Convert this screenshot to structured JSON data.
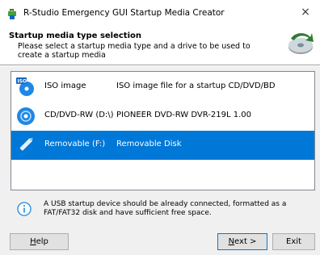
{
  "window": {
    "title": "R-Studio Emergency GUI Startup Media Creator",
    "close_label": "×"
  },
  "header": {
    "title": "Startup media type selection",
    "description": "Please select a startup media type and a drive to be used to create a startup media"
  },
  "media_list": [
    {
      "name": "ISO image",
      "description": "ISO image file for a startup CD/DVD/BD",
      "icon": "iso-icon",
      "selected": false
    },
    {
      "name": "CD/DVD-RW (D:\\)",
      "description": "PIONEER DVD-RW DVR-219L 1.00",
      "icon": "optical-disc-icon",
      "selected": false
    },
    {
      "name": "Removable (F:)",
      "description": "Removable Disk",
      "icon": "usb-drive-icon",
      "selected": true
    }
  ],
  "info": {
    "text": "A USB startup device should be already connected, formatted as a FAT/FAT32 disk and have sufficient free space."
  },
  "buttons": {
    "help_first": "H",
    "help_rest": "elp",
    "next_first": "N",
    "next_rest": "ext >",
    "exit": "Exit"
  },
  "colors": {
    "selection": "#0078d7",
    "background": "#f0f0f0"
  }
}
